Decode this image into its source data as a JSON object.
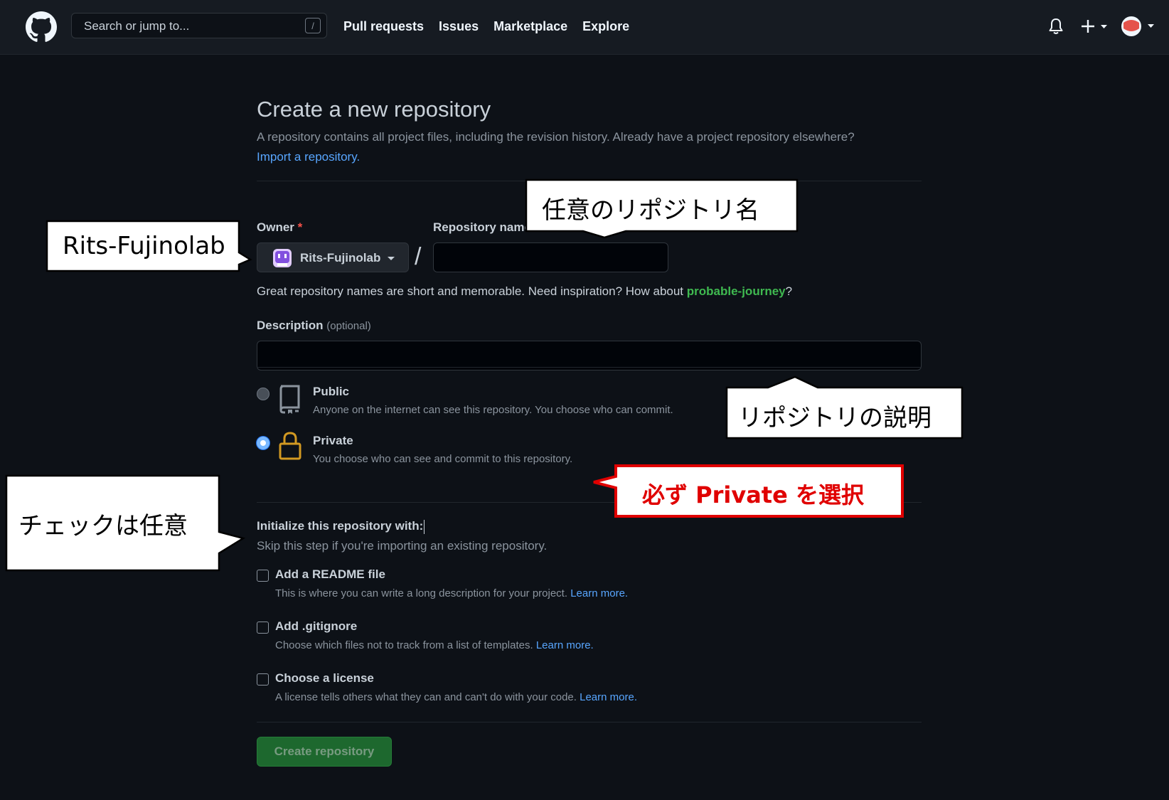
{
  "header": {
    "search_placeholder": "Search or jump to...",
    "search_shortcut": "/",
    "nav": [
      "Pull requests",
      "Issues",
      "Marketplace",
      "Explore"
    ]
  },
  "page": {
    "title": "Create a new repository",
    "subtitle": "A repository contains all project files, including the revision history. Already have a project repository elsewhere?",
    "import_link": "Import a repository."
  },
  "form": {
    "owner_label": "Owner",
    "required_mark": "*",
    "repo_name_label": "Repository name",
    "owner_value": "Rits-Fujinolab",
    "separator": "/",
    "repo_name_value": "",
    "hint_prefix": "Great repository names are short and memorable. Need inspiration? How about ",
    "hint_suggestion": "probable-journey",
    "hint_suffix": "?",
    "description_label": "Description",
    "description_optional": "(optional)",
    "description_value": ""
  },
  "visibility": {
    "selected": "private",
    "public": {
      "title": "Public",
      "desc": "Anyone on the internet can see this repository. You choose who can commit."
    },
    "private": {
      "title": "Private",
      "desc": "You choose who can see and commit to this repository."
    }
  },
  "init": {
    "title": "Initialize this repository with:",
    "subtitle": "Skip this step if you're importing an existing repository.",
    "options": [
      {
        "title": "Add a README file",
        "desc": "This is where you can write a long description for your project.",
        "link": "Learn more.",
        "checked": false
      },
      {
        "title": "Add .gitignore",
        "desc": "Choose which files not to track from a list of templates.",
        "link": "Learn more.",
        "checked": false
      },
      {
        "title": "Choose a license",
        "desc": "A license tells others what they can and can't do with your code.",
        "link": "Learn more.",
        "checked": false
      }
    ]
  },
  "create_button": "Create repository",
  "annotations": {
    "owner": "Rits-Fujinolab",
    "repo_name": "任意のリポジトリ名",
    "description": "リポジトリの説明",
    "private_note": "必ず Private を選択",
    "check_optional": "チェックは任意"
  },
  "colors": {
    "background": "#0d1117",
    "header": "#161b22",
    "link": "#58a6ff",
    "suggestion": "#3fb950",
    "primary_button": "#238636",
    "private_icon": "#d29922",
    "callout_red": "#e00000"
  }
}
